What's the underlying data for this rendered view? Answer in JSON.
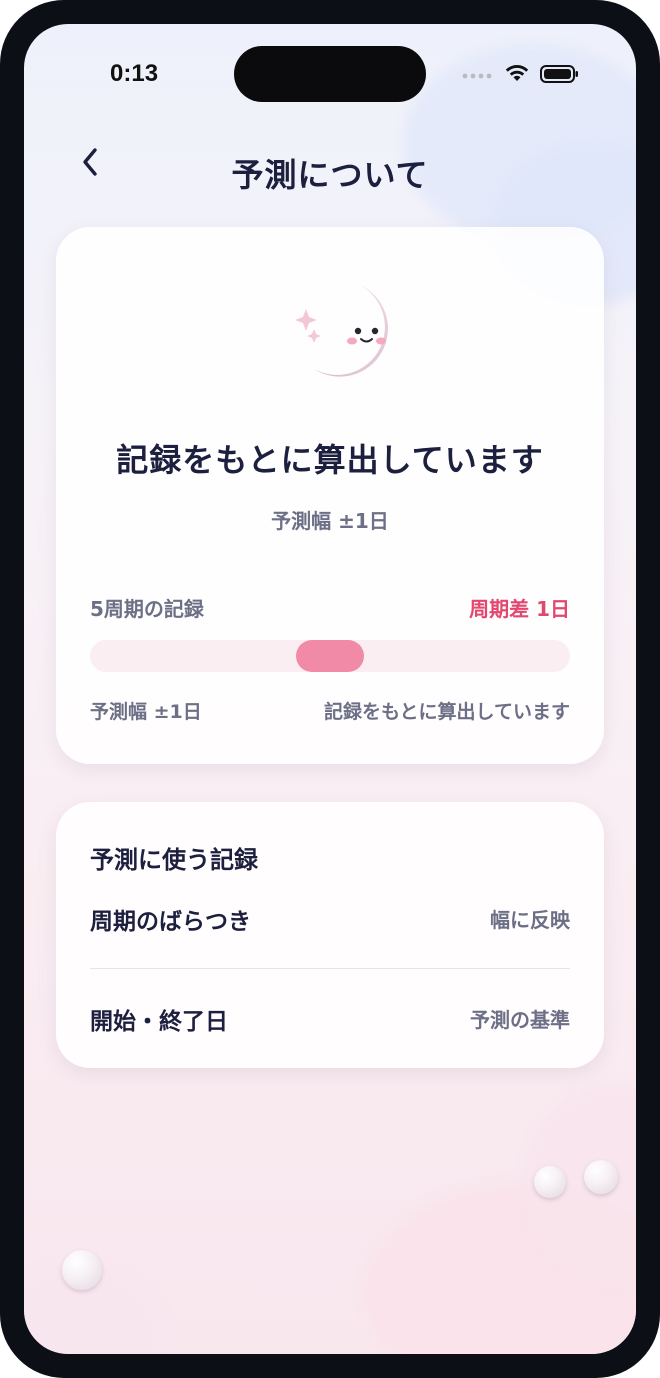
{
  "status_bar": {
    "time": "0:13",
    "icons": [
      "signal-icon",
      "wifi-icon",
      "battery-icon"
    ]
  },
  "header": {
    "back_icon": "chevron-left-icon",
    "title": "予測について"
  },
  "prediction_card": {
    "mascot": "crescent-moon-mascot-icon",
    "heading": "記録をもとに算出しています",
    "subtitle": "予測幅 ±1日",
    "period_label": "5周期の記録",
    "period_diff": "周期差 1日",
    "range_left_label": "予測幅 ±1日",
    "range_right_label": "記録をもとに算出しています",
    "range_bar": {
      "start_fraction": 0.43,
      "end_fraction": 0.57,
      "color": "#f08aa6",
      "track_color": "#fbeef2"
    }
  },
  "records_card": {
    "title": "予測に使う記録",
    "items": [
      {
        "label": "周期のばらつき",
        "value": "幅に反映"
      },
      {
        "label": "開始・終了日",
        "value": "予測の基準"
      }
    ]
  },
  "colors": {
    "title_text": "#1c1f3e",
    "muted_text": "#6d6f86",
    "accent_pink": "#e3476f"
  }
}
